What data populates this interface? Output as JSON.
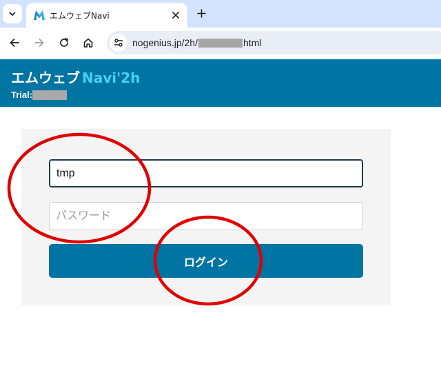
{
  "browser": {
    "tab_title": "エムウェブNavi",
    "favicon_letter": "M",
    "url_prefix": "nogenius.jp/2h/",
    "url_suffix": "html",
    "icons": {
      "tab_menu": "chevron-down-icon",
      "tab_close": "close-icon",
      "new_tab": "plus-icon",
      "back": "arrow-left-icon",
      "forward": "arrow-right-icon",
      "reload": "reload-icon",
      "home": "home-icon",
      "site_info": "tune-icon"
    }
  },
  "header": {
    "brand_main": "エムウェブ",
    "brand_sub": "Navi'2h",
    "trial_label": "Trial:",
    "colors": {
      "background": "#0074a2",
      "brand_sub": "#45d2f2"
    }
  },
  "login": {
    "username_value": "tmp",
    "password_placeholder": "パスワード",
    "submit_label": "ログイン",
    "button_color": "#0074a2"
  },
  "annotation": {
    "circle_color": "#e00000"
  }
}
